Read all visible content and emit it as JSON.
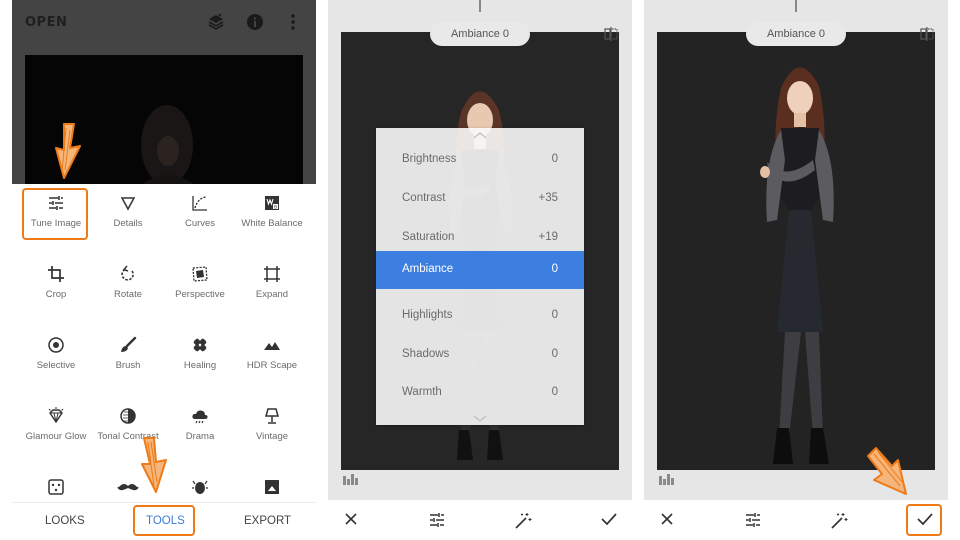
{
  "editor": {
    "open_label": "OPEN",
    "top_icons": [
      "layers-icon",
      "info-icon",
      "more-vert-icon"
    ],
    "tools": [
      {
        "label": "Tune Image",
        "icon": "tune-icon"
      },
      {
        "label": "Details",
        "icon": "triangle-icon"
      },
      {
        "label": "Curves",
        "icon": "curves-icon"
      },
      {
        "label": "White Balance",
        "icon": "white-balance-icon"
      },
      {
        "label": "Crop",
        "icon": "crop-icon"
      },
      {
        "label": "Rotate",
        "icon": "rotate-icon"
      },
      {
        "label": "Perspective",
        "icon": "perspective-icon"
      },
      {
        "label": "Expand",
        "icon": "expand-icon"
      },
      {
        "label": "Selective",
        "icon": "selective-icon"
      },
      {
        "label": "Brush",
        "icon": "brush-icon"
      },
      {
        "label": "Healing",
        "icon": "healing-icon"
      },
      {
        "label": "HDR Scape",
        "icon": "mountains-icon"
      },
      {
        "label": "Glamour Glow",
        "icon": "diamond-icon"
      },
      {
        "label": "Tonal Contrast",
        "icon": "tonal-contrast-icon"
      },
      {
        "label": "Drama",
        "icon": "cloud-icon"
      },
      {
        "label": "Vintage",
        "icon": "lamp-icon"
      }
    ],
    "partial_tools": [
      "grunge-icon",
      "mustache-icon",
      "bug-icon",
      "frame-icon"
    ],
    "nav": {
      "looks": "LOOKS",
      "tools": "TOOLS",
      "export": "EXPORT"
    }
  },
  "tune_menu": {
    "pill": "Ambiance 0",
    "items": [
      {
        "label": "Brightness",
        "value": "0"
      },
      {
        "label": "Contrast",
        "value": "+35"
      },
      {
        "label": "Saturation",
        "value": "+19"
      },
      {
        "label": "Ambiance",
        "value": "0",
        "selected": true
      },
      {
        "label": "Highlights",
        "value": "0"
      },
      {
        "label": "Shadows",
        "value": "0"
      },
      {
        "label": "Warmth",
        "value": "0"
      }
    ]
  },
  "result": {
    "pill": "Ambiance 0"
  },
  "bottom_bar_icons": [
    "close-icon",
    "sliders-icon",
    "magic-wand-icon",
    "check-icon"
  ],
  "colors": {
    "accent": "#3d7fe0",
    "highlight_orange": "#ee7b17",
    "nav_active": "#3b7bd4"
  }
}
